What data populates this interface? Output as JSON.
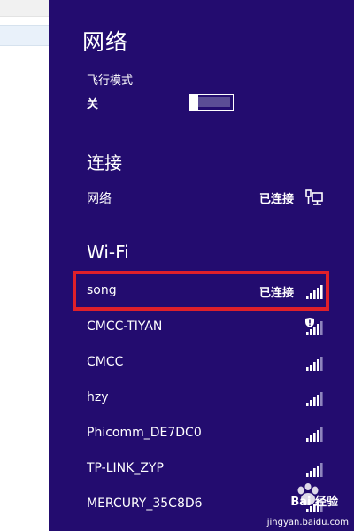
{
  "panel": {
    "title": "网络",
    "background": "#230c6f"
  },
  "airplane_mode": {
    "label": "飞行模式",
    "state": "关",
    "on": false
  },
  "connections": {
    "title": "连接",
    "items": [
      {
        "name": "网络",
        "status": "已连接",
        "icon": "wired-network-icon"
      }
    ]
  },
  "wifi": {
    "title": "Wi-Fi",
    "networks": [
      {
        "name": "song",
        "status": "已连接",
        "icon": "wifi-signal-icon",
        "signal_bars": 5,
        "highlighted": true
      },
      {
        "name": "CMCC-TIYAN",
        "status": "",
        "icon": "wifi-signal-shield-icon",
        "signal_bars": 4,
        "secured_warning": true
      },
      {
        "name": "CMCC",
        "status": "",
        "icon": "wifi-signal-icon",
        "signal_bars": 4
      },
      {
        "name": "hzy",
        "status": "",
        "icon": "wifi-signal-icon",
        "signal_bars": 4
      },
      {
        "name": "Phicomm_DE7DC0",
        "status": "",
        "icon": "wifi-signal-icon",
        "signal_bars": 4
      },
      {
        "name": "TP-LINK_ZYP",
        "status": "",
        "icon": "wifi-signal-icon",
        "signal_bars": 4
      },
      {
        "name": "MERCURY_35C8D6",
        "status": "",
        "icon": "wifi-signal-icon",
        "signal_bars": 4
      }
    ]
  },
  "highlight_color": "#e0202a",
  "watermark": {
    "brand": "Bai 经验",
    "url": "jingyan.baidu.com"
  }
}
